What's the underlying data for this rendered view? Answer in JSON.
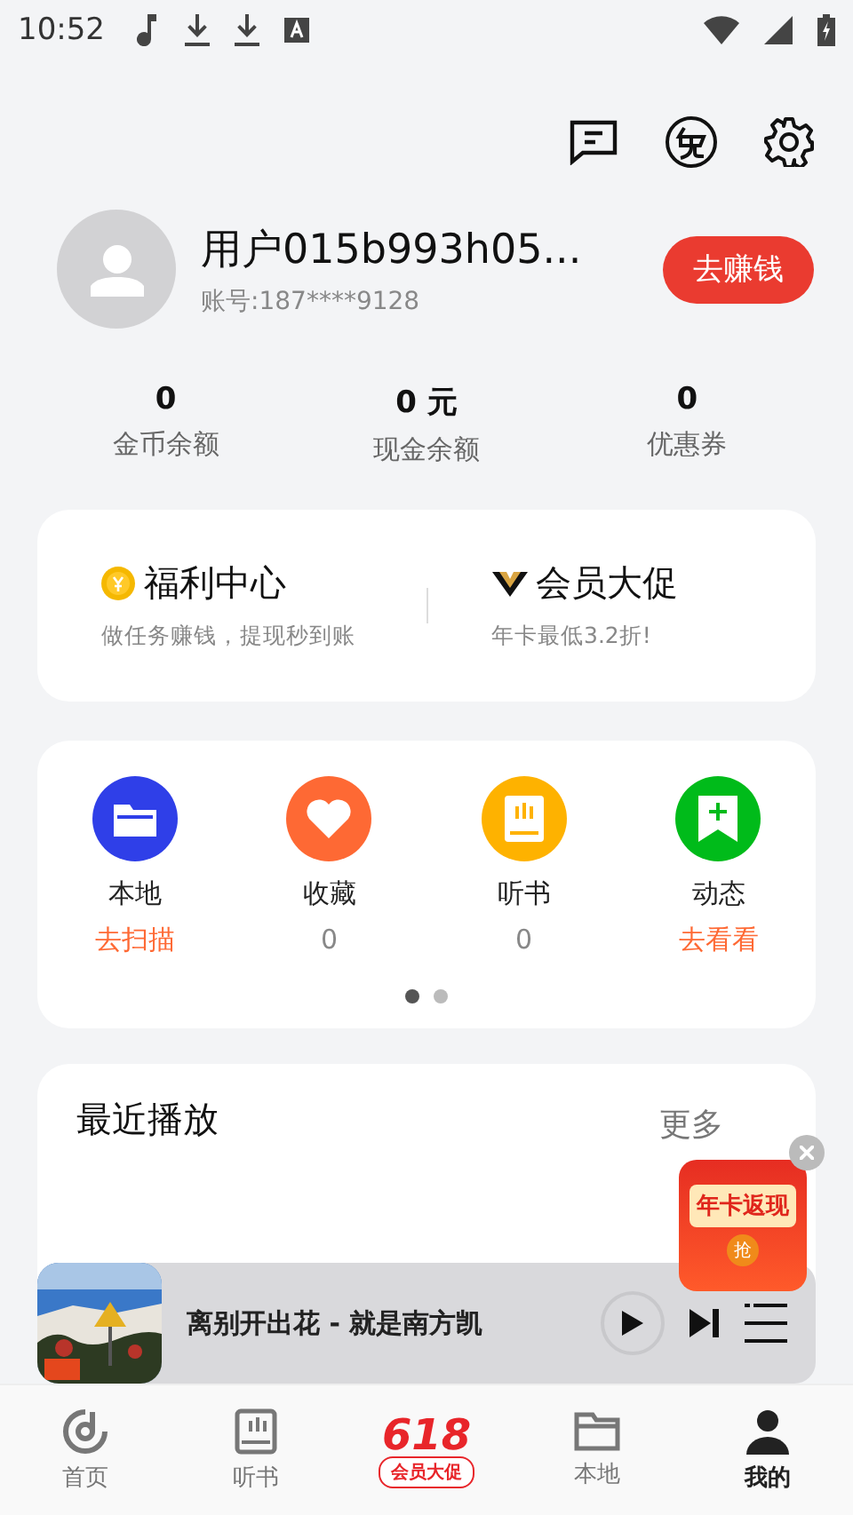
{
  "status_bar": {
    "time": "10:52"
  },
  "profile": {
    "name": "用户015b993h05...",
    "account": "账号:187****9128",
    "earn_button": "去赚钱"
  },
  "stats": [
    {
      "value": "0",
      "label": "金币余额"
    },
    {
      "value": "0 元",
      "label": "现金余额"
    },
    {
      "value": "0",
      "label": "优惠券"
    }
  ],
  "promos": [
    {
      "kind": "coin",
      "title": "福利中心",
      "subtitle": "做任务赚钱，提现秒到账"
    },
    {
      "kind": "vip",
      "title": "会员大促",
      "subtitle": "年卡最低3.2折!"
    }
  ],
  "shortcuts": [
    {
      "kind": "folder",
      "color": "#2f3fe8",
      "label": "本地",
      "sub": "去扫描",
      "action": true
    },
    {
      "kind": "heart",
      "color": "#fe6934",
      "label": "收藏",
      "sub": "0",
      "action": false
    },
    {
      "kind": "book",
      "color": "#feb200",
      "label": "听书",
      "sub": "0",
      "action": false
    },
    {
      "kind": "bookmark",
      "color": "#00bb1a",
      "label": "动态",
      "sub": "去看看",
      "action": true
    }
  ],
  "pager": [
    {
      "selected": true
    },
    {
      "selected": false
    }
  ],
  "recent": {
    "title": "最近播放",
    "more": "更多"
  },
  "promo_badge": {
    "title": "年卡返现",
    "action": "抢"
  },
  "player": {
    "track": "离别开出花 - 就是南方凯"
  },
  "nav": [
    {
      "kind": "home",
      "label": "首页",
      "selected": false
    },
    {
      "kind": "book",
      "label": "听书",
      "selected": false
    },
    {
      "kind": "promo",
      "badge": "618",
      "label": "会员大促",
      "selected": false
    },
    {
      "kind": "folder",
      "label": "本地",
      "selected": false
    },
    {
      "kind": "user",
      "label": "我的",
      "selected": true
    }
  ]
}
